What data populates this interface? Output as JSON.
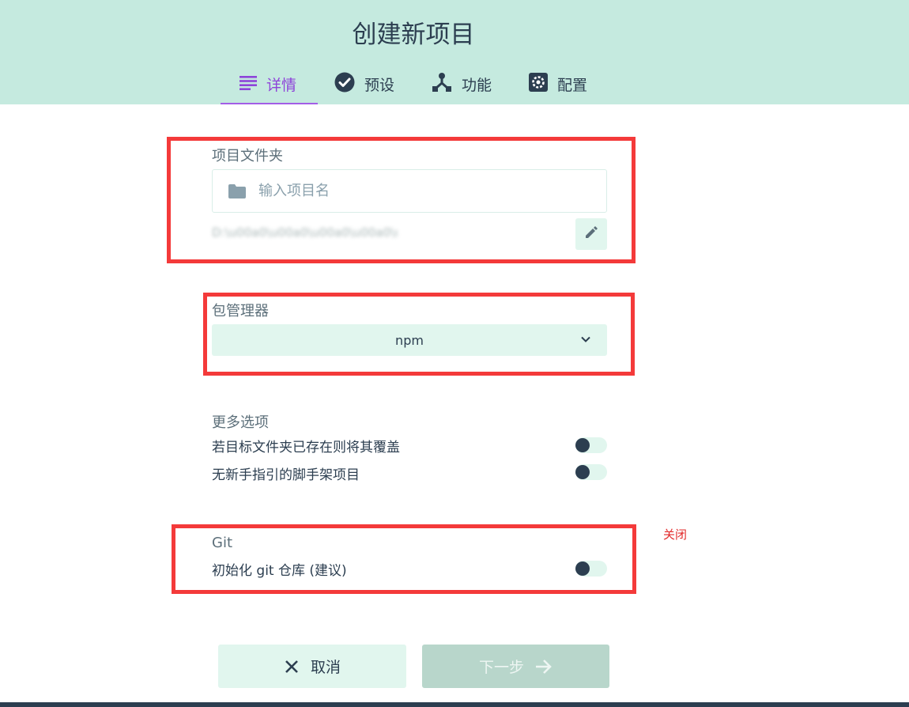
{
  "header": {
    "title": "创建新项目",
    "tabs": [
      {
        "label": "详情",
        "icon": "subject-icon",
        "active": true
      },
      {
        "label": "预设",
        "icon": "check-circle-icon",
        "active": false
      },
      {
        "label": "功能",
        "icon": "device-hub-icon",
        "active": false
      },
      {
        "label": "配置",
        "icon": "settings-icon",
        "active": false
      }
    ]
  },
  "folder": {
    "label": "项目文件夹",
    "placeholder": "输入项目名",
    "path": "D:\\u00a0\\u00a0\\u00a0\\u00a0\\u00a0\\u00a0\\u00a0\\u00a0\\u00a0\\u00a0\\u00a0\\u00a0"
  },
  "package_manager": {
    "label": "包管理器",
    "selected": "npm"
  },
  "more_options": {
    "label": "更多选项",
    "items": [
      {
        "label": "若目标文件夹已存在则将其覆盖",
        "enabled": false
      },
      {
        "label": "无新手指引的脚手架项目",
        "enabled": false
      }
    ]
  },
  "git": {
    "label": "Git",
    "init_label": "初始化 git 仓库 (建议)",
    "enabled": false,
    "annotation": "关闭"
  },
  "footer": {
    "cancel_label": "取消",
    "next_label": "下一步"
  },
  "colors": {
    "header_bg": "#c5eadf",
    "accent": "#8e44d9",
    "highlight_box": "#f43a3a",
    "dark": "#2c3e50",
    "light_green": "#e1f6ee"
  }
}
